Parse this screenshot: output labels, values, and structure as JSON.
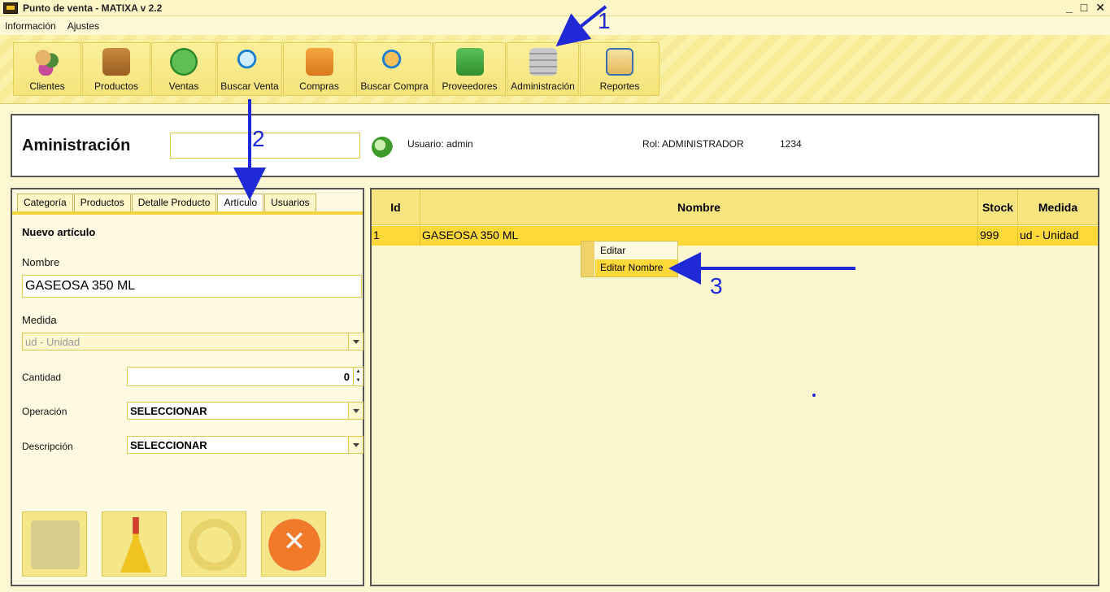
{
  "window": {
    "title": "Punto de venta - MATIXA v 2.2",
    "minimize": "_",
    "maximize": "□",
    "close": "✕"
  },
  "menu": [
    "Información",
    "Ajustes"
  ],
  "toolbar": [
    {
      "label": "Clientes",
      "icon": "clients-icon"
    },
    {
      "label": "Productos",
      "icon": "box-icon"
    },
    {
      "label": "Ventas",
      "icon": "dollar-icon"
    },
    {
      "label": "Buscar Venta",
      "icon": "magnifier-icon"
    },
    {
      "label": "Compras",
      "icon": "basket-icon"
    },
    {
      "label": "Buscar Compra",
      "icon": "magnifier-box-icon"
    },
    {
      "label": "Proveedores",
      "icon": "supplier-icon"
    },
    {
      "label": "Administración",
      "icon": "database-icon"
    },
    {
      "label": "Reportes",
      "icon": "clipboard-icon"
    }
  ],
  "header": {
    "title": "Aministración",
    "search_value": "",
    "user": "Usuario: admin",
    "role": "Rol: ADMINISTRADOR",
    "code": "1234"
  },
  "tabs": [
    {
      "label": "Categoría",
      "active": false
    },
    {
      "label": "Productos",
      "active": false
    },
    {
      "label": "Detalle Producto",
      "active": false
    },
    {
      "label": "Artículo",
      "active": true
    },
    {
      "label": "Usuarios",
      "active": false
    }
  ],
  "form": {
    "section_title": "Nuevo artículo",
    "nombre_label": "Nombre",
    "nombre_value": "GASEOSA 350 ML",
    "medida_label": "Medida",
    "medida_value": "ud - Unidad",
    "cantidad_label": "Cantidad",
    "cantidad_value": "0",
    "operacion_label": "Operación",
    "operacion_value": "SELECCIONAR",
    "descripcion_label": "Descripción",
    "descripcion_value": "SELECCIONAR"
  },
  "table": {
    "columns": [
      "Id",
      "Nombre",
      "Stock",
      "Medida"
    ],
    "rows": [
      [
        "1",
        "GASEOSA 350 ML",
        "999",
        "ud - Unidad"
      ]
    ]
  },
  "context_menu": {
    "items": [
      "Editar",
      "Editar Nombre"
    ],
    "highlighted": 1
  },
  "annotations": {
    "step1": "1",
    "step2": "2",
    "step3": "3",
    "color": "#1f2ad6"
  }
}
